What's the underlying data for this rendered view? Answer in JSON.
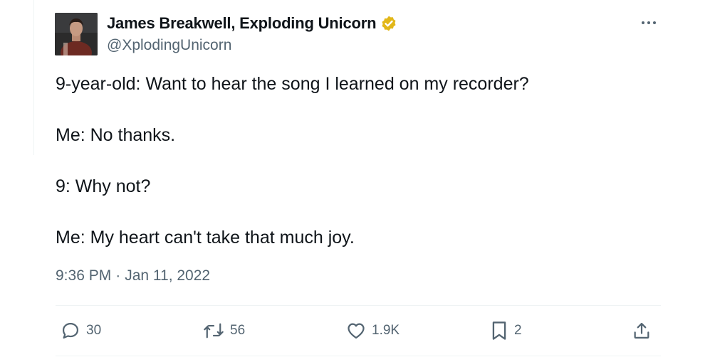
{
  "author": {
    "name": "James Breakwell, Exploding Unicorn",
    "handle": "@XplodingUnicorn",
    "verified": true,
    "verified_color": "#e2b719"
  },
  "tweet": {
    "lines": [
      "9-year-old: Want to hear the song I learned on my recorder?",
      "Me: No thanks.",
      "9: Why not?",
      "Me: My heart can't take that much joy."
    ],
    "time": "9:36 PM",
    "separator": "·",
    "date": "Jan 11, 2022"
  },
  "actions": {
    "reply_count": "30",
    "retweet_count": "56",
    "like_count": "1.9K",
    "bookmark_count": "2"
  },
  "icons": {
    "more": "more-icon",
    "reply": "reply-icon",
    "retweet": "retweet-icon",
    "like": "heart-icon",
    "bookmark": "bookmark-icon",
    "share": "share-icon",
    "verified": "verified-badge-icon"
  },
  "colors": {
    "text": "#0f1419",
    "secondary": "#536471",
    "divider": "#eff3f4"
  }
}
